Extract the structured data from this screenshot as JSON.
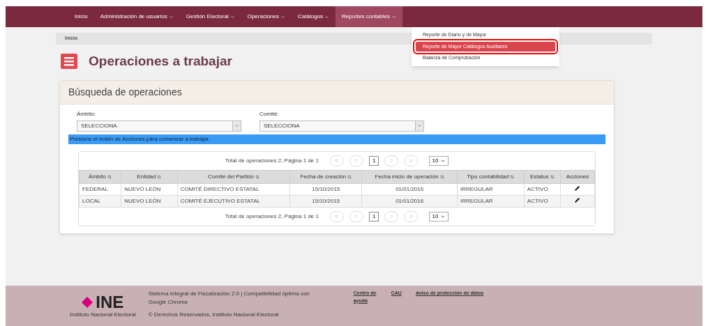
{
  "nav": {
    "items": [
      {
        "label": "Inicio",
        "has_menu": false,
        "selected": false
      },
      {
        "label": "Administración de usuarios",
        "has_menu": true,
        "selected": false
      },
      {
        "label": "Gestión Electoral",
        "has_menu": true,
        "selected": false
      },
      {
        "label": "Operaciones",
        "has_menu": true,
        "selected": false
      },
      {
        "label": "Catálogos",
        "has_menu": true,
        "selected": false
      },
      {
        "label": "Reportes contables",
        "has_menu": true,
        "selected": true
      }
    ],
    "dropdown": [
      {
        "label": "Reporte de Diario y de Mayor",
        "selected": false
      },
      {
        "label": "Reporte de Mayor Catálogos Auxiliares",
        "selected": true
      },
      {
        "label": "Balanza de Comprobación",
        "selected": false
      }
    ]
  },
  "breadcrumb": "Inicio",
  "page_title": "Operaciones a trabajar",
  "panel": {
    "title": "Búsqueda de operaciones",
    "fields": [
      {
        "label": "Ámbito:",
        "value": "SELECCIONA"
      },
      {
        "label": "Comité:",
        "value": "SELECCIONA"
      }
    ],
    "info": "Presione el botón de Acciones para comenzar a trabajar."
  },
  "table": {
    "pager_top": {
      "summary": "Total de operaciones 2, Página 1 de 1",
      "page": "1",
      "page_size": "10"
    },
    "columns": [
      "Ámbito",
      "Entidad",
      "Comité del Partido",
      "Fecha de creación",
      "Fecha inicio de operación",
      "Tipo contabilidad",
      "Estatus",
      "Acciones"
    ],
    "rows": [
      {
        "cells": [
          "FEDERAL",
          "NUEVO LEÓN",
          "COMITÉ DIRECTIVO ESTATAL",
          "15/10/2015",
          "01/01/2016",
          "IRREGULAR",
          "ACTIVO"
        ]
      },
      {
        "cells": [
          "LOCAL",
          "NUEVO LEÓN",
          "COMITÉ EJECUTIVO ESTATAL",
          "15/10/2015",
          "01/01/2016",
          "IRREGULAR",
          "ACTIVO"
        ]
      }
    ],
    "pager_bottom": {
      "summary": "Total de operaciones 2, Página 1 de 1",
      "page": "1",
      "page_size": "10"
    }
  },
  "footer": {
    "logo_text": "INE",
    "logo_subtitle": "Instituto Nacional Electoral",
    "info": "Sistema Integral de Fiscalización 2.0 | Compatibilidad óptima con Google Chrome",
    "copyright": "© Derechos Reservados, Instituto Nacional Electoral",
    "links": [
      "Centro de ayuda",
      "CAU",
      "Aviso de protección de datos"
    ]
  }
}
